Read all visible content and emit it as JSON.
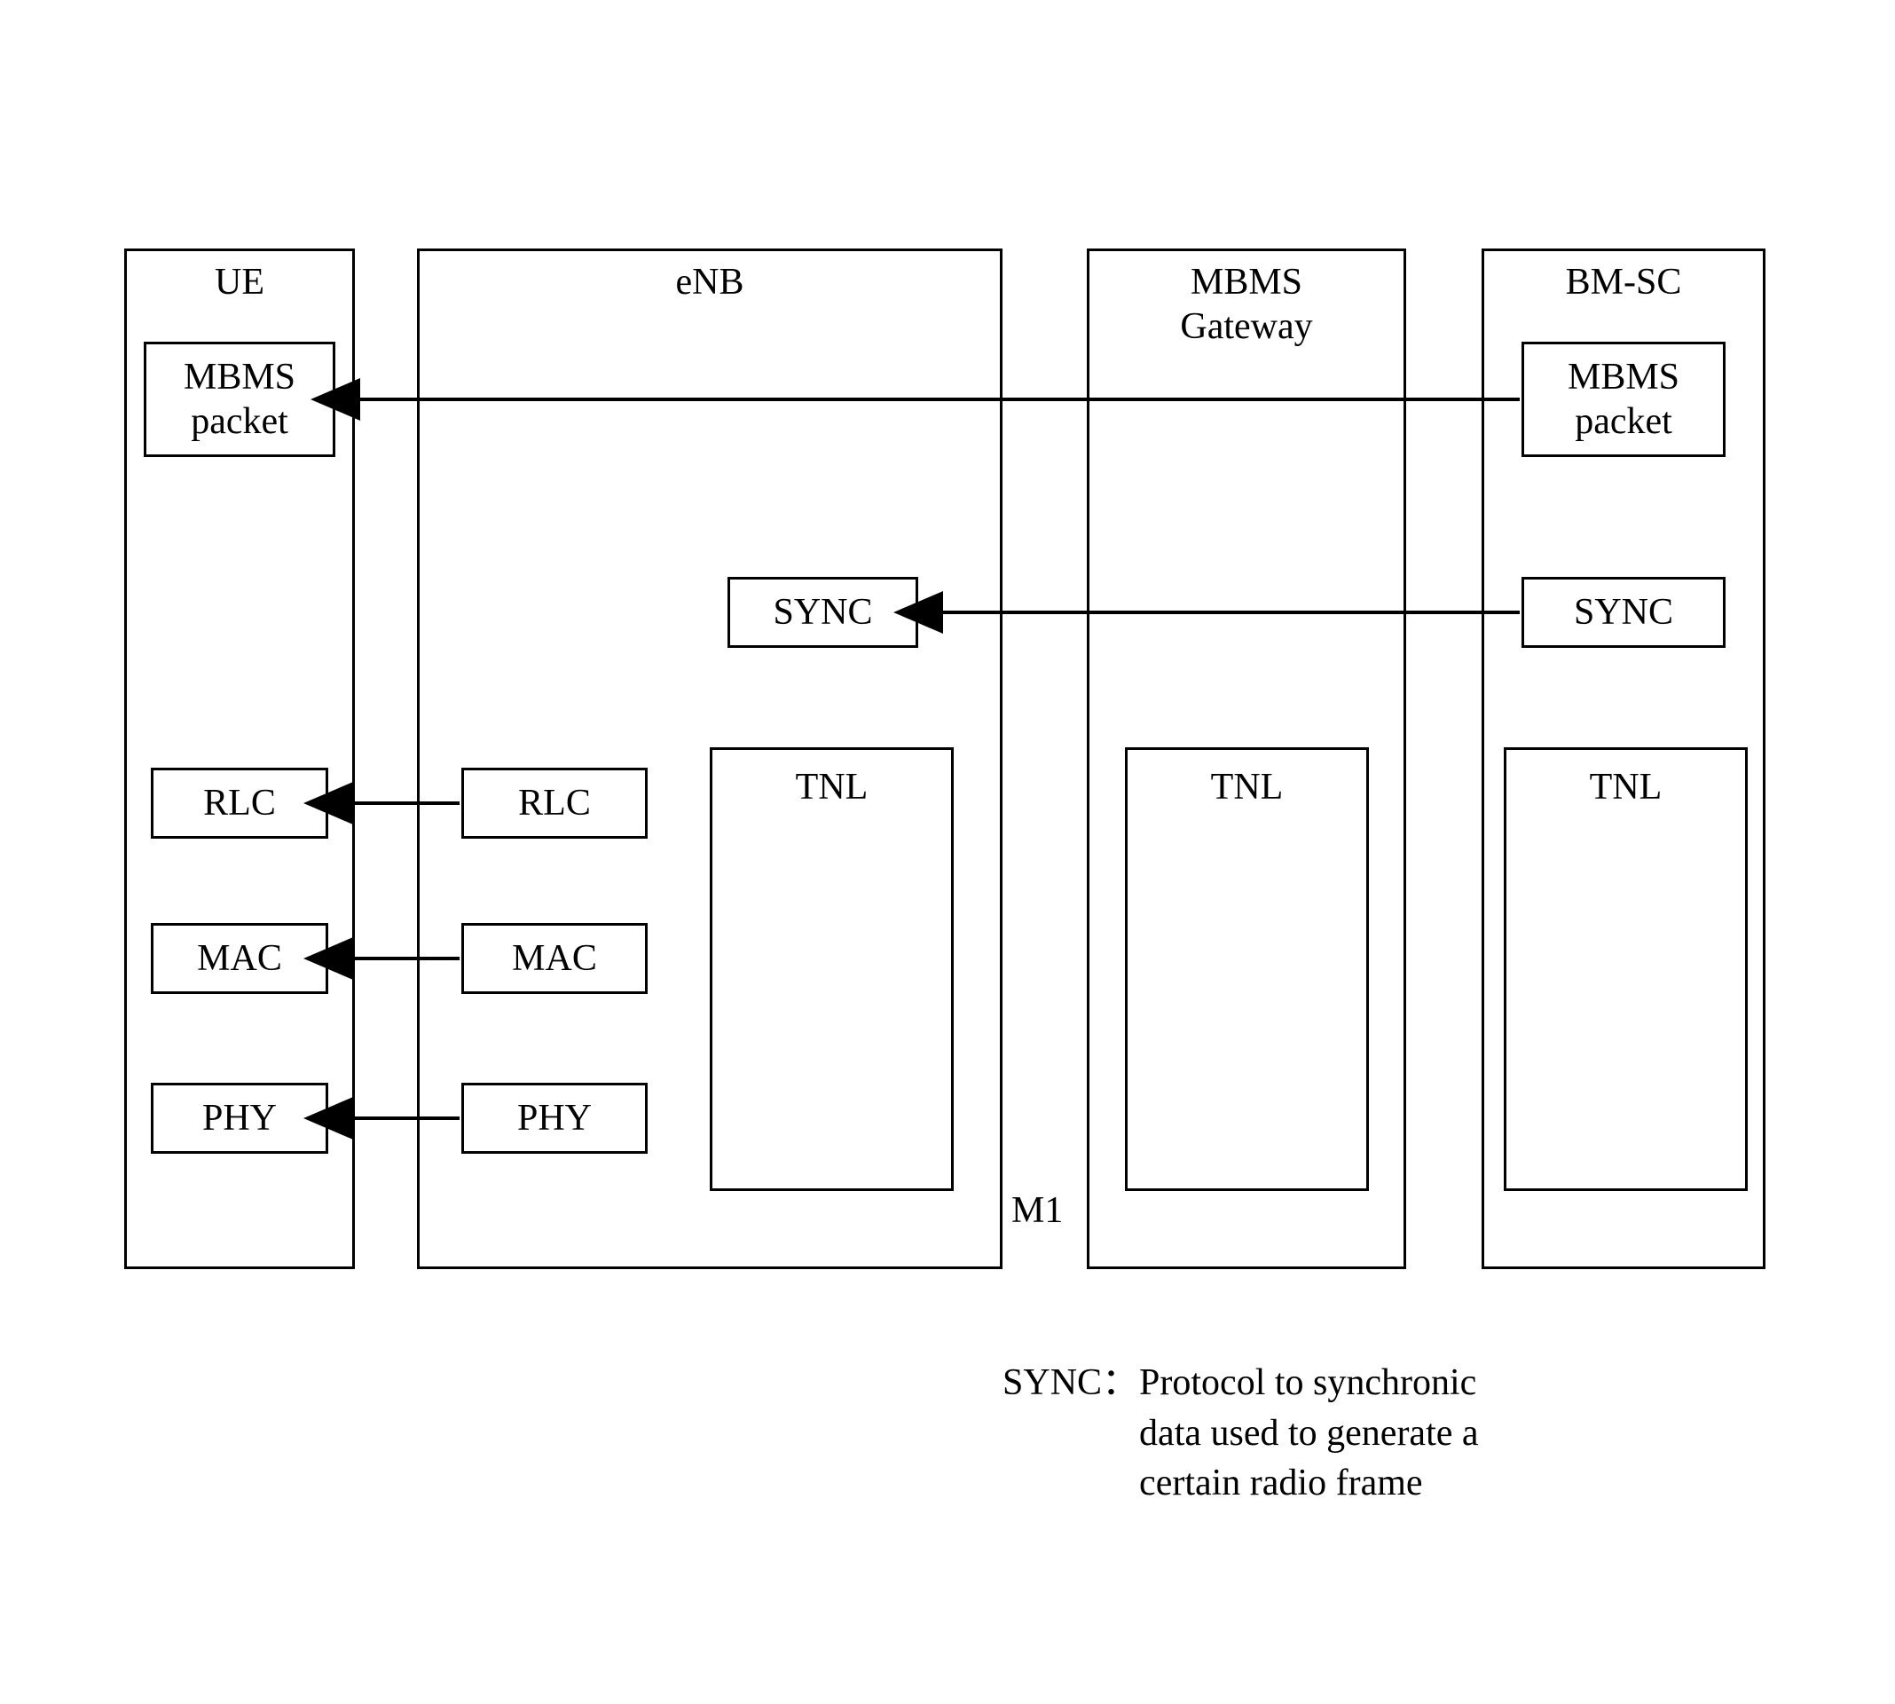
{
  "nodes": {
    "ue": {
      "title": "UE"
    },
    "enb": {
      "title": "eNB"
    },
    "mbms_gw": {
      "title": "MBMS\nGateway"
    },
    "bmsc": {
      "title": "BM-SC"
    }
  },
  "layers": {
    "ue": {
      "mbms_packet": "MBMS\npacket",
      "rlc": "RLC",
      "mac": "MAC",
      "phy": "PHY"
    },
    "enb": {
      "sync": "SYNC",
      "rlc": "RLC",
      "mac": "MAC",
      "phy": "PHY",
      "tnl": "TNL"
    },
    "mbms_gw": {
      "tnl": "TNL"
    },
    "bmsc": {
      "mbms_packet": "MBMS\npacket",
      "sync": "SYNC",
      "tnl": "TNL"
    }
  },
  "interfaces": {
    "m1": "M1"
  },
  "footnote": {
    "label": "SYNC：",
    "text1": "Protocol to synchronic",
    "text2": "data used to generate a",
    "text3": "certain radio frame"
  }
}
